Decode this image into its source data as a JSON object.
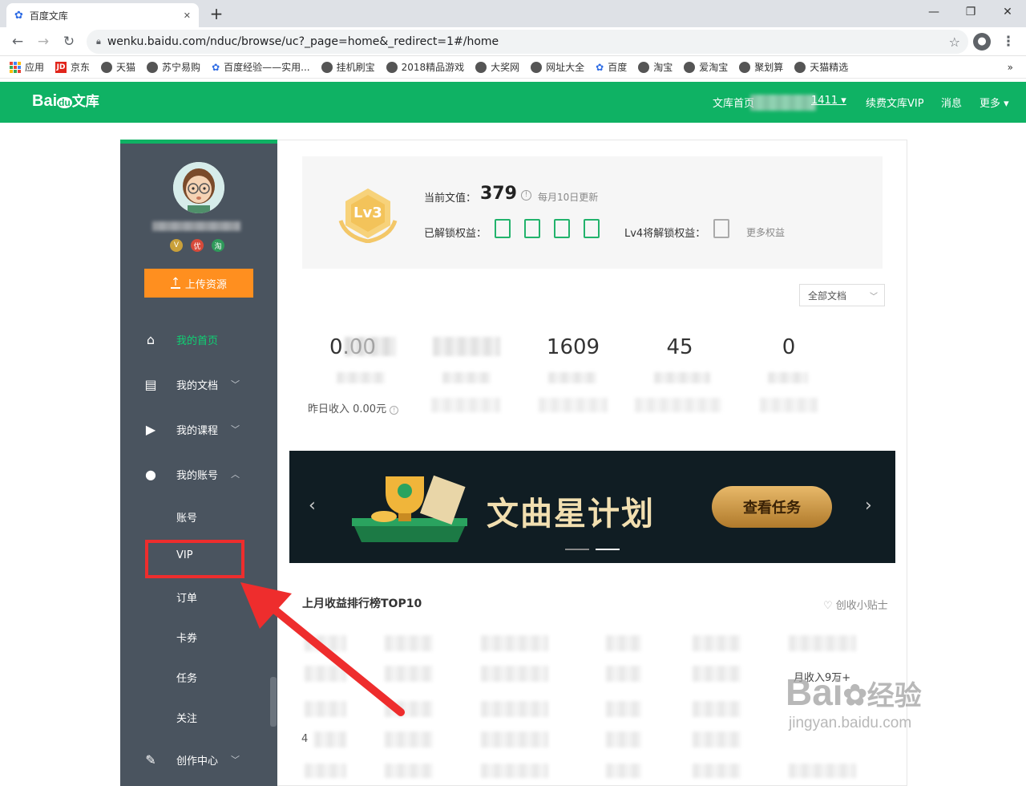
{
  "browser": {
    "tab_title": "百度文库",
    "tab_close": "✕",
    "new_tab": "+",
    "url": "wenku.baidu.com/nduc/browse/uc?_page=home&_redirect=1#/home",
    "bookmarks": [
      "应用",
      "京东",
      "天猫",
      "苏宁易购",
      "百度经验——实用...",
      "挂机刷宝",
      "2018精品游戏",
      "大奖网",
      "网址大全",
      "百度",
      "淘宝",
      "爱淘宝",
      "聚划算",
      "天猫精选"
    ],
    "more_bookmarks": "»"
  },
  "header": {
    "logo": "Bai",
    "logo_paw": "du",
    "logo_suffix": "文库",
    "nav_home": "文库首页",
    "user_suffix": "1411 ▾",
    "nav_vip": "续费文库VIP",
    "nav_msg": "消息",
    "nav_more": "更多 ▾"
  },
  "sidebar": {
    "badges": [
      "V",
      "优",
      "淘"
    ],
    "upload_label": "上传资源",
    "items": [
      {
        "label": "我的首页",
        "chev": ""
      },
      {
        "label": "我的文档",
        "chev": "﹀"
      },
      {
        "label": "我的课程",
        "chev": "﹀"
      },
      {
        "label": "我的账号",
        "chev": "︿"
      },
      {
        "label": "创作中心",
        "chev": "﹀"
      }
    ],
    "sub_items": [
      "账号",
      "VIP",
      "订单",
      "卡券",
      "任务",
      "关注"
    ]
  },
  "level": {
    "badge": "Lv3",
    "value_label": "当前文值：",
    "value": "379",
    "update_note": "每月10日更新",
    "unlocked_label": "已解锁权益：",
    "next_label": "Lv4将解锁权益：",
    "more_link": "更多权益"
  },
  "filter": {
    "selected": "全部文档",
    "arrow": "﹀"
  },
  "stats": {
    "values": [
      "0.00",
      "",
      "1609",
      "45",
      "0"
    ],
    "yesterday": "昨日收入 0.00元"
  },
  "banner": {
    "title": "文曲星计划",
    "button": "查看任务",
    "prev": "‹",
    "next": "›"
  },
  "ranking": {
    "title": "上月收益排行榜TOP10",
    "tip": "创收小贴士",
    "visible_text": [
      "月收入9万+",
      "4"
    ]
  },
  "watermark": {
    "line1": "Bai",
    "line2": "经验",
    "line3": "jingyan.baidu.com"
  }
}
